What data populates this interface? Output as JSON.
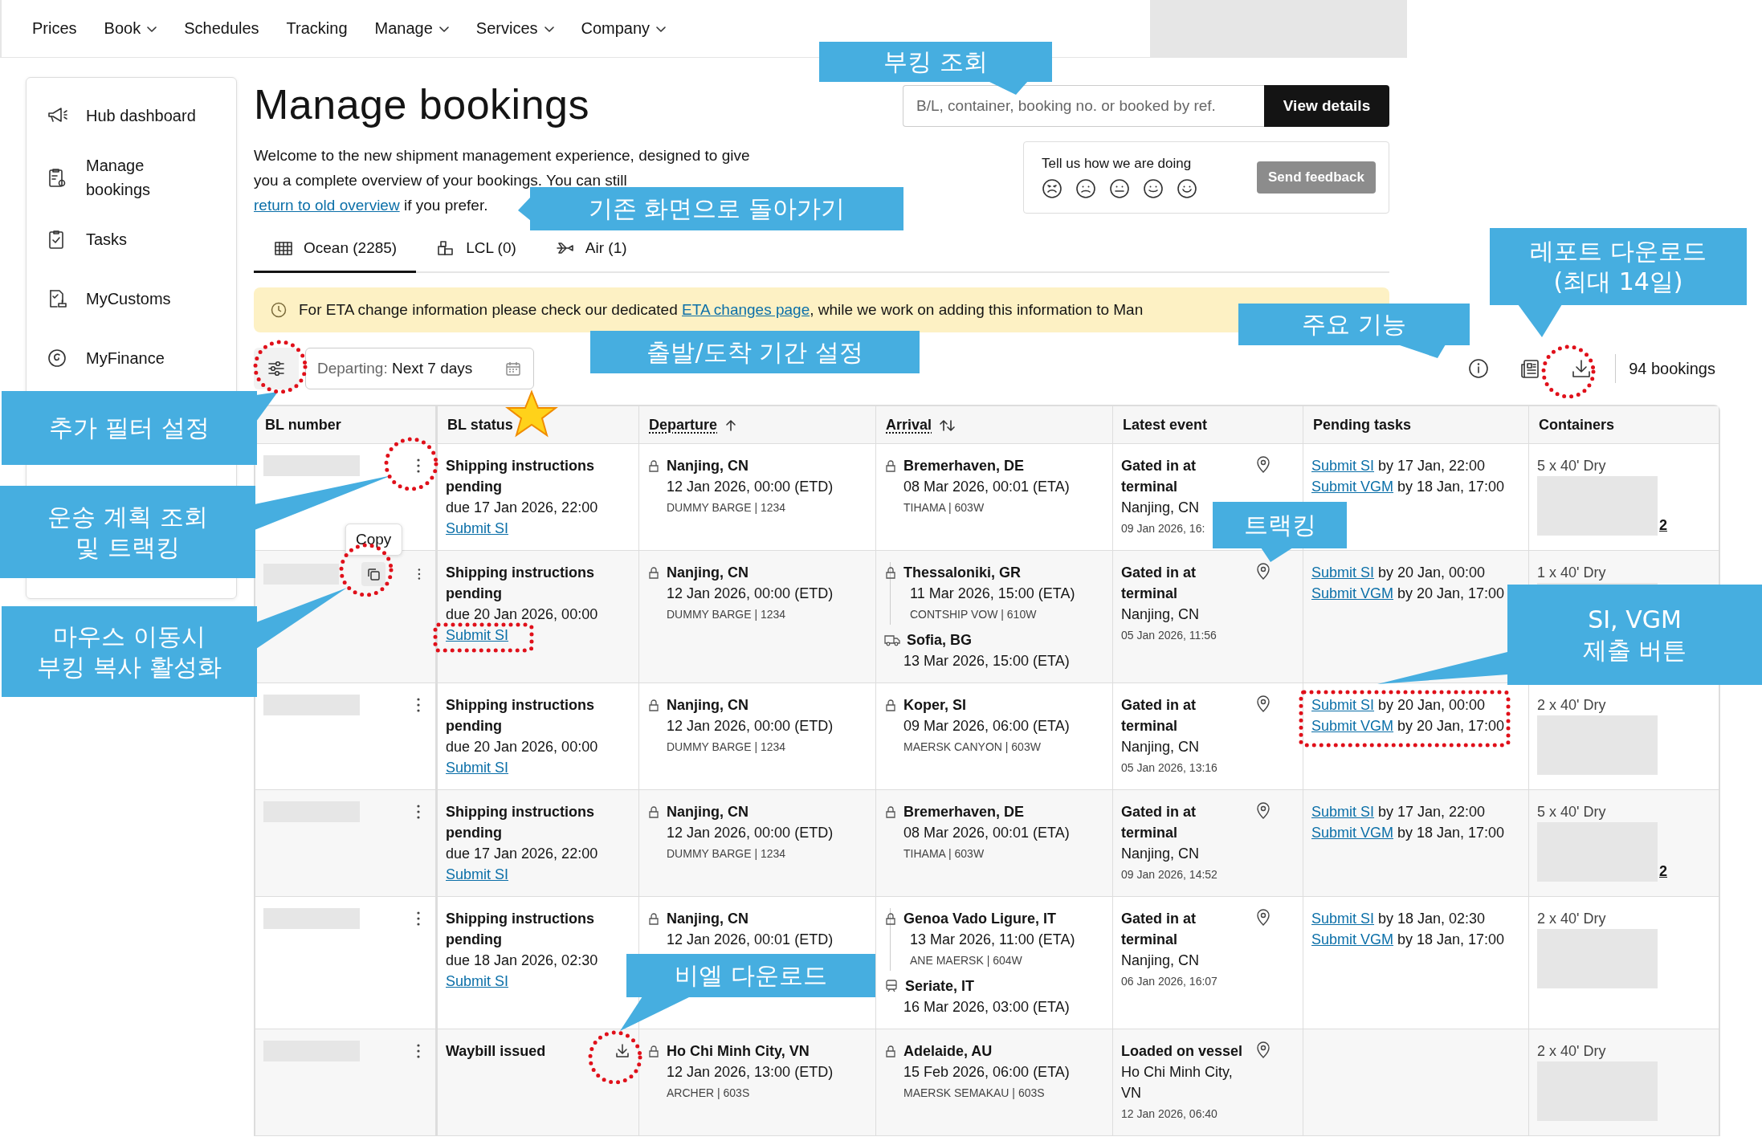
{
  "nav": [
    {
      "label": "Prices",
      "dropdown": false
    },
    {
      "label": "Book",
      "dropdown": true
    },
    {
      "label": "Schedules",
      "dropdown": false
    },
    {
      "label": "Tracking",
      "dropdown": false
    },
    {
      "label": "Manage",
      "dropdown": true
    },
    {
      "label": "Services",
      "dropdown": true
    },
    {
      "label": "Company",
      "dropdown": true
    }
  ],
  "sidebar": {
    "items": [
      {
        "label": "Hub dashboard"
      },
      {
        "label": "Manage bookings"
      },
      {
        "label": "Tasks"
      },
      {
        "label": "MyCustoms"
      },
      {
        "label": "MyFinance"
      }
    ]
  },
  "page": {
    "title": "Manage bookings",
    "intro_before": "Welcome to the new shipment management experience, designed to give you a complete overview of your bookings. You can still ",
    "intro_link": "return to old overview",
    "intro_after": " if you prefer."
  },
  "search": {
    "placeholder": "B/L, container, booking no. or booked by ref.",
    "button": "View details"
  },
  "feedback": {
    "prompt": "Tell us how we are doing",
    "button": "Send feedback"
  },
  "tabs": [
    {
      "label": "Ocean (2285)",
      "selected": true
    },
    {
      "label": "LCL (0)",
      "selected": false
    },
    {
      "label": "Air (1)",
      "selected": false
    }
  ],
  "notice": {
    "before": "For ETA change information please check our dedicated ",
    "link": "ETA changes page",
    "after": ", while we work on adding this information to Man"
  },
  "filter": {
    "label": "Departing:",
    "value": "Next 7 days"
  },
  "booking_count": "94 bookings",
  "table": {
    "copy_tooltip": "Copy",
    "columns": [
      {
        "label": "BL number",
        "sortable": false
      },
      {
        "label": "BL status",
        "sortable": false
      },
      {
        "label": "Departure",
        "sortable": true,
        "sorted": true
      },
      {
        "label": "Arrival",
        "sortable": true,
        "sorted": false
      },
      {
        "label": "Latest event",
        "sortable": false
      },
      {
        "label": "Pending tasks",
        "sortable": false
      },
      {
        "label": "Containers",
        "sortable": false
      }
    ],
    "rows": [
      {
        "hovered": false,
        "bl_download": false,
        "status": {
          "title": "Shipping instructions pending",
          "due": "due 17 Jan 2026, 22:00",
          "action": "Submit SI"
        },
        "departure": {
          "place": "Nanjing, CN",
          "time": "12 Jan 2026, 00:00 (ETD)",
          "vessel": "DUMMY BARGE | 1234"
        },
        "arrival": [
          {
            "kind": "port",
            "place": "Bremerhaven, DE",
            "time": "08 Mar 2026, 00:01 (ETA)",
            "vessel": "TIHAMA | 603W"
          }
        ],
        "latest": {
          "event": "Gated in at terminal",
          "place": "Nanjing, CN",
          "time": "09 Jan 2026, 16:"
        },
        "pending": [
          {
            "link": "Submit SI",
            "due": "by 17 Jan, 22:00"
          },
          {
            "link": "Submit VGM",
            "due": "by 18 Jan, 17:00"
          }
        ],
        "containers": {
          "summary": "5 x 40' Dry",
          "more": "2"
        }
      },
      {
        "hovered": true,
        "bl_download": false,
        "status": {
          "title": "Shipping instructions pending",
          "due": "due 20 Jan 2026, 00:00",
          "action": "Submit SI"
        },
        "departure": {
          "place": "Nanjing, CN",
          "time": "12 Jan 2026, 00:00 (ETD)",
          "vessel": "DUMMY BARGE | 1234"
        },
        "arrival": [
          {
            "kind": "port",
            "place": "Thessaloniki, GR",
            "time": "11 Mar 2026, 15:00 (ETA)",
            "vessel": "CONTSHIP VOW | 610W"
          },
          {
            "kind": "road",
            "place": "Sofia, BG",
            "time": "13 Mar 2026, 15:00 (ETA)"
          }
        ],
        "latest": {
          "event": "Gated in at terminal",
          "place": "Nanjing, CN",
          "time": "05 Jan 2026, 11:56"
        },
        "pending": [
          {
            "link": "Submit SI",
            "due": "by 20 Jan, 00:00"
          },
          {
            "link": "Submit VGM",
            "due": "by 20 Jan, 17:00"
          }
        ],
        "containers": {
          "summary": "1 x 40' Dry"
        }
      },
      {
        "hovered": false,
        "bl_download": false,
        "status": {
          "title": "Shipping instructions pending",
          "due": "due 20 Jan 2026, 00:00",
          "action": "Submit SI"
        },
        "departure": {
          "place": "Nanjing, CN",
          "time": "12 Jan 2026, 00:00 (ETD)",
          "vessel": "DUMMY BARGE | 1234"
        },
        "arrival": [
          {
            "kind": "port",
            "place": "Koper, SI",
            "time": "09 Mar 2026, 06:00 (ETA)",
            "vessel": "MAERSK CANYON | 603W"
          }
        ],
        "latest": {
          "event": "Gated in at terminal",
          "place": "Nanjing, CN",
          "time": "05 Jan 2026, 13:16"
        },
        "pending": [
          {
            "link": "Submit SI",
            "due": "by 20 Jan, 00:00"
          },
          {
            "link": "Submit VGM",
            "due": "by 20 Jan, 17:00"
          }
        ],
        "containers": {
          "summary": "2 x 40' Dry"
        }
      },
      {
        "hovered": false,
        "bl_download": false,
        "status": {
          "title": "Shipping instructions pending",
          "due": "due 17 Jan 2026, 22:00",
          "action": "Submit SI"
        },
        "departure": {
          "place": "Nanjing, CN",
          "time": "12 Jan 2026, 00:00 (ETD)",
          "vessel": "DUMMY BARGE | 1234"
        },
        "arrival": [
          {
            "kind": "port",
            "place": "Bremerhaven, DE",
            "time": "08 Mar 2026, 00:01 (ETA)",
            "vessel": "TIHAMA | 603W"
          }
        ],
        "latest": {
          "event": "Gated in at terminal",
          "place": "Nanjing, CN",
          "time": "09 Jan 2026, 14:52"
        },
        "pending": [
          {
            "link": "Submit SI",
            "due": "by 17 Jan, 22:00"
          },
          {
            "link": "Submit VGM",
            "due": "by 18 Jan, 17:00"
          }
        ],
        "containers": {
          "summary": "5 x 40' Dry",
          "more": "2"
        }
      },
      {
        "hovered": false,
        "bl_download": false,
        "status": {
          "title": "Shipping instructions pending",
          "due": "due 18 Jan 2026, 02:30",
          "action": "Submit SI"
        },
        "departure": {
          "place": "Nanjing, CN",
          "time": "12 Jan 2026, 00:01 (ETD)"
        },
        "arrival": [
          {
            "kind": "port",
            "place": "Genoa Vado Ligure, IT",
            "time": "13 Mar 2026, 11:00 (ETA)",
            "vessel": "ANE MAERSK | 604W"
          },
          {
            "kind": "rail",
            "place": "Seriate, IT",
            "time": "16 Mar 2026, 03:00 (ETA)"
          }
        ],
        "latest": {
          "event": "Gated in at terminal",
          "place": "Nanjing, CN",
          "time": "06 Jan 2026, 16:07"
        },
        "pending": [
          {
            "link": "Submit SI",
            "due": "by 18 Jan, 02:30"
          },
          {
            "link": "Submit VGM",
            "due": "by 18 Jan, 17:00"
          }
        ],
        "containers": {
          "summary": "2 x 40' Dry"
        }
      },
      {
        "hovered": false,
        "bl_download": true,
        "status": {
          "title": "Waybill issued"
        },
        "departure": {
          "place": "Ho Chi Minh City, VN",
          "time": "12 Jan 2026, 13:00 (ETD)",
          "vessel": "ARCHER | 603S"
        },
        "arrival": [
          {
            "kind": "port",
            "place": "Adelaide, AU",
            "time": "15 Feb 2026, 06:00 (ETA)",
            "vessel": "MAERSK SEMAKAU | 603S"
          }
        ],
        "latest": {
          "event": "Loaded on vessel",
          "place": "Ho Chi Minh City, VN",
          "time": "12 Jan 2026, 06:40"
        },
        "containers": {
          "summary": "2 x 40' Dry"
        }
      }
    ]
  },
  "annotations": [
    {
      "text": "부킹 조회"
    },
    {
      "text": "기존 화면으로 돌아가기"
    },
    {
      "text": "레포트 다운로드\n(최대 14일)"
    },
    {
      "text": "주요 기능"
    },
    {
      "text": "출발/도착 기간 설정"
    },
    {
      "text": "추가 필터 설정"
    },
    {
      "text": "운송 계획 조회\n및 트랙킹"
    },
    {
      "text": "트랙킹"
    },
    {
      "text": "마우스 이동시\n부킹 복사 활성화"
    },
    {
      "text": "SI, VGM\n제출 버튼"
    },
    {
      "text": "비엘 다운로드"
    }
  ]
}
